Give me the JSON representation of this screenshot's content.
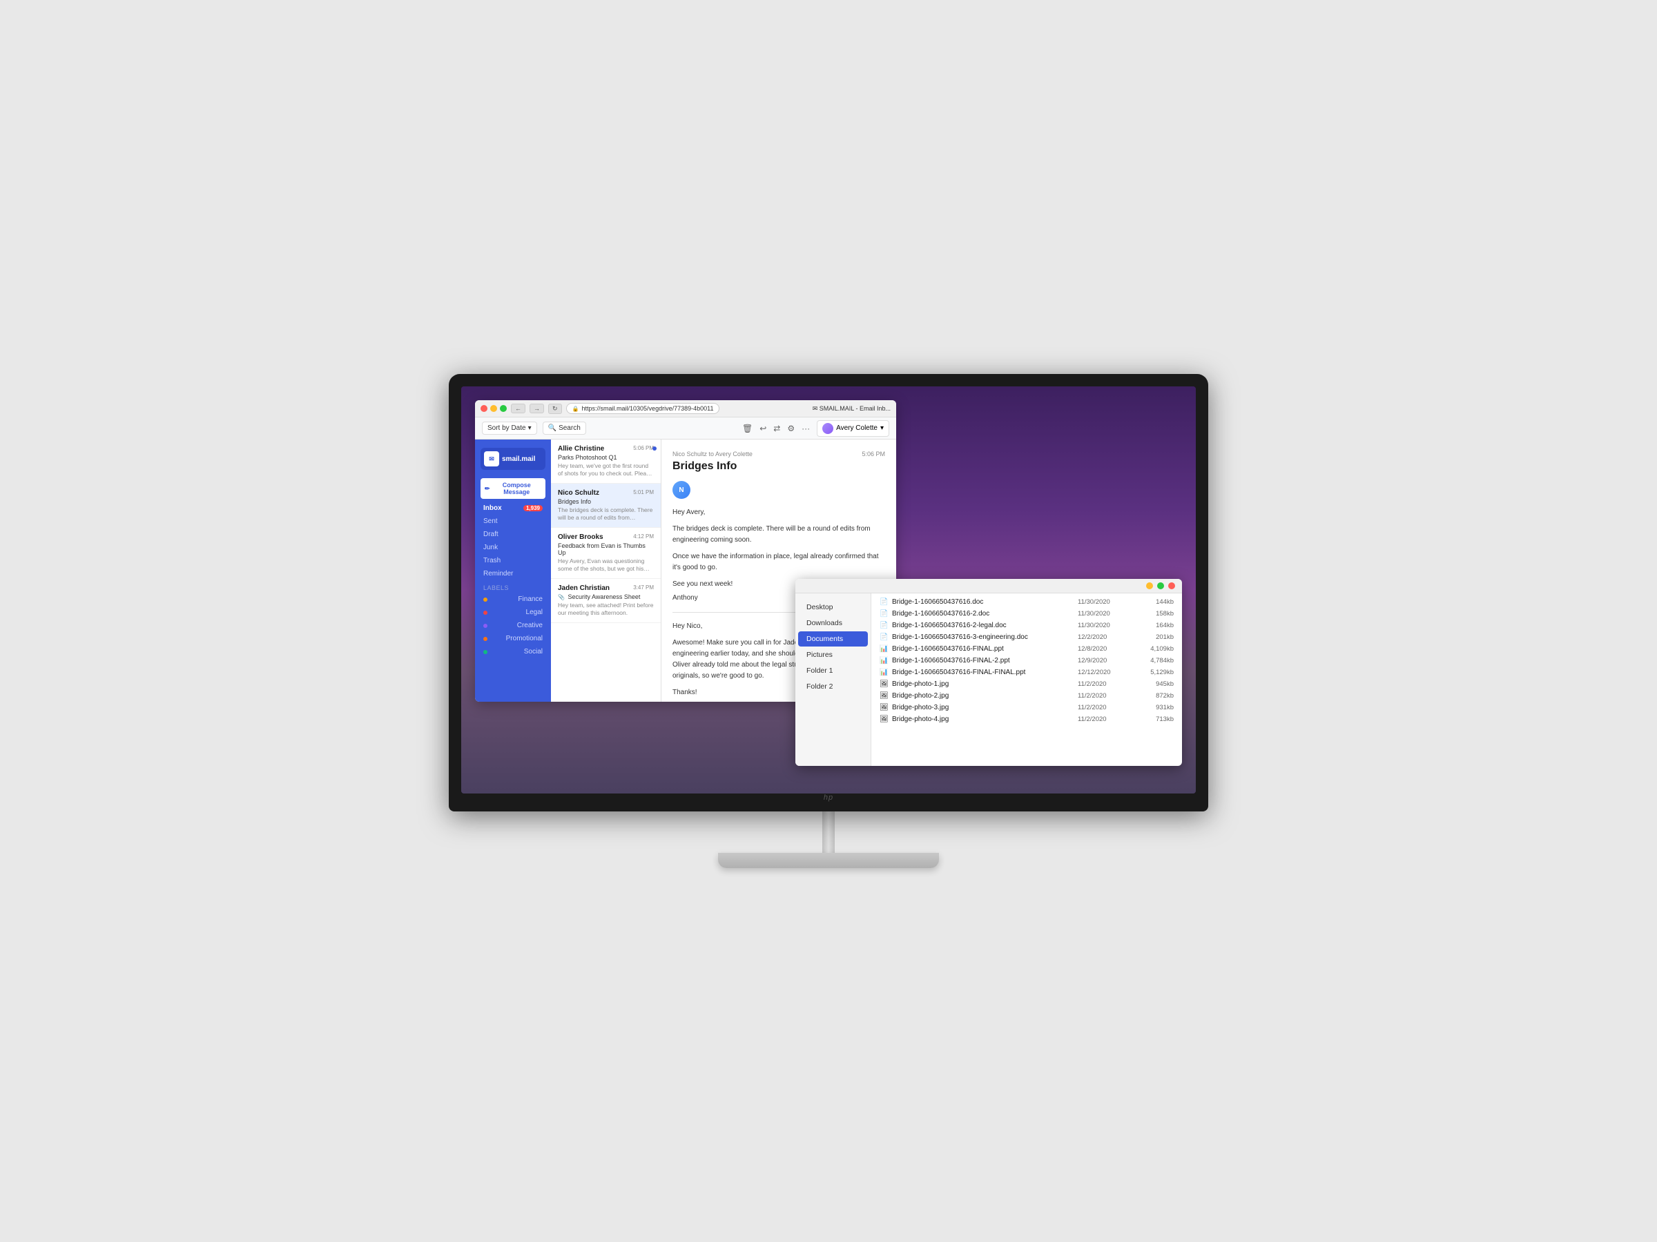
{
  "monitor": {
    "hp_logo": "hp"
  },
  "browser": {
    "title": "SMAIL.MAIL - Email Inb...",
    "tab": "✉ SMAIL.MAIL - Email Inb...",
    "url": "https://smail.mail/10305/vegdrive/77389-4b0011",
    "secure_label": "Secure"
  },
  "email_app": {
    "logo_text": "smail.mail",
    "compose_btn": "Compose Message",
    "nav": [
      {
        "label": "Inbox",
        "count": "1,939",
        "active": true
      },
      {
        "label": "Sent",
        "count": "",
        "active": false
      },
      {
        "label": "Draft",
        "count": "",
        "active": false
      },
      {
        "label": "Junk",
        "count": "",
        "active": false
      },
      {
        "label": "Trash",
        "count": "",
        "active": false
      },
      {
        "label": "Reminder",
        "count": "",
        "active": false
      }
    ],
    "labels_section": "Labels",
    "labels": [
      {
        "name": "Finance",
        "color": "#f59e0b"
      },
      {
        "name": "Legal",
        "color": "#ef4444"
      },
      {
        "name": "Creative",
        "color": "#8b5cf6"
      },
      {
        "name": "Promotional",
        "color": "#f97316"
      },
      {
        "name": "Social",
        "color": "#10b981"
      }
    ],
    "toolbar": {
      "sort_by": "Sort by Date",
      "search": "Search",
      "delete_icon": "🗑",
      "undo_icon": "↩",
      "redo_icon": "⇄",
      "settings_icon": "⚙",
      "more_icon": "···",
      "user_name": "Avery Colette"
    },
    "emails": [
      {
        "sender": "Allie Christine",
        "subject": "Parks Photoshoot Q1",
        "preview": "Hey team, we've got the first round of shots for you to check out. Please let me know your...",
        "time": "5:06 PM",
        "unread": true,
        "attachment": false
      },
      {
        "sender": "Nico Schultz",
        "subject": "Bridges Info",
        "preview": "The bridges deck is complete. There will be a round of edits from engineering coming soon...",
        "time": "5:01 PM",
        "unread": false,
        "attachment": false,
        "selected": true
      },
      {
        "sender": "Oliver Brooks",
        "subject": "Feedback from Evan is Thumbs Up",
        "preview": "Hey Avery, Evan was questioning some of the shots, but we got his signoff to proceed with initiative",
        "time": "4:12 PM",
        "unread": false,
        "attachment": false
      },
      {
        "sender": "Jaden Christian",
        "subject": "Security Awareness Sheet",
        "preview": "Hey team, see attached! Print before our meeting this afternoon.",
        "time": "3:47 PM",
        "unread": false,
        "attachment": true
      }
    ],
    "reading_pane": {
      "from_label": "Nico Schultz to Avery Colette",
      "time": "5:06 PM",
      "subject": "Bridges Info",
      "sender_initial": "N",
      "body_1": "Hey Avery,",
      "body_2": "The bridges deck is complete. There will be a round of edits from engineering coming soon.",
      "body_3": "Once we have the information in place, legal already confirmed that it's good to go.",
      "body_4": "See you next week!",
      "body_5": "Anthony",
      "reply_body_1": "Hey Nico,",
      "reply_body_2": "Awesome! Make sure you call in for Jaden's meeting. She spoke with engineering earlier today, and she should have some great feedback. Oliver already told me about the legal stuff, and I'm looking at Allie's originals, so we're good to go.",
      "reply_body_3": "Thanks!"
    }
  },
  "file_manager": {
    "sidebar": [
      {
        "label": "Desktop",
        "active": false
      },
      {
        "label": "Downloads",
        "active": false
      },
      {
        "label": "Documents",
        "active": true
      },
      {
        "label": "Pictures",
        "active": false
      },
      {
        "label": "Folder 1",
        "active": false
      },
      {
        "label": "Folder 2",
        "active": false
      }
    ],
    "files": [
      {
        "name": "Bridge-1-1606650437616.doc",
        "date": "11/30/2020",
        "size": "144kb",
        "type": "doc"
      },
      {
        "name": "Bridge-1-1606650437616-2.doc",
        "date": "11/30/2020",
        "size": "158kb",
        "type": "doc"
      },
      {
        "name": "Bridge-1-1606650437616-2-legal.doc",
        "date": "11/30/2020",
        "size": "164kb",
        "type": "doc"
      },
      {
        "name": "Bridge-1-1606650437616-3-engineering.doc",
        "date": "12/2/2020",
        "size": "201kb",
        "type": "doc"
      },
      {
        "name": "Bridge-1-1606650437616-FINAL.ppt",
        "date": "12/8/2020",
        "size": "4,109kb",
        "type": "ppt"
      },
      {
        "name": "Bridge-1-1606650437616-FINAL-2.ppt",
        "date": "12/9/2020",
        "size": "4,784kb",
        "type": "ppt"
      },
      {
        "name": "Bridge-1-1606650437616-FINAL-FINAL.ppt",
        "date": "12/12/2020",
        "size": "5,129kb",
        "type": "ppt"
      },
      {
        "name": "Bridge-photo-1.jpg",
        "date": "11/2/2020",
        "size": "945kb",
        "type": "jpg"
      },
      {
        "name": "Bridge-photo-2.jpg",
        "date": "11/2/2020",
        "size": "872kb",
        "type": "jpg"
      },
      {
        "name": "Bridge-photo-3.jpg",
        "date": "11/2/2020",
        "size": "931kb",
        "type": "jpg"
      },
      {
        "name": "Bridge-photo-4.jpg",
        "date": "11/2/2020",
        "size": "713kb",
        "type": "jpg"
      }
    ]
  }
}
